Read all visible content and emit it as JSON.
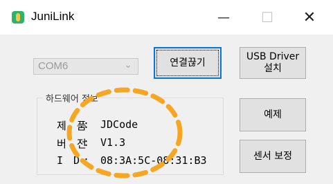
{
  "window": {
    "title": "JuniLink",
    "minimize_glyph": "—",
    "maximize_glyph": "☐",
    "close_glyph": "✕"
  },
  "port_select": {
    "value": "COM6",
    "icon": "chevron-down-icon"
  },
  "buttons": {
    "connect": "연결끊기",
    "usb_driver": "USB Driver\n설치",
    "example": "예제",
    "sensor_calibration": "센서 보정"
  },
  "hardware_info": {
    "title": "하드웨어 정보",
    "rows": [
      {
        "label": "제 품",
        "sep": ":",
        "value": "JDCode"
      },
      {
        "label": "버 전",
        "sep": ":",
        "value": "V1.3"
      },
      {
        "label": "I D",
        "sep": ":",
        "value": "08:3A:5C-08:31:B3"
      }
    ]
  },
  "colors": {
    "accent": "#0078d7",
    "annotation": "#f5a623",
    "disabled_text": "#9a9a9a"
  }
}
